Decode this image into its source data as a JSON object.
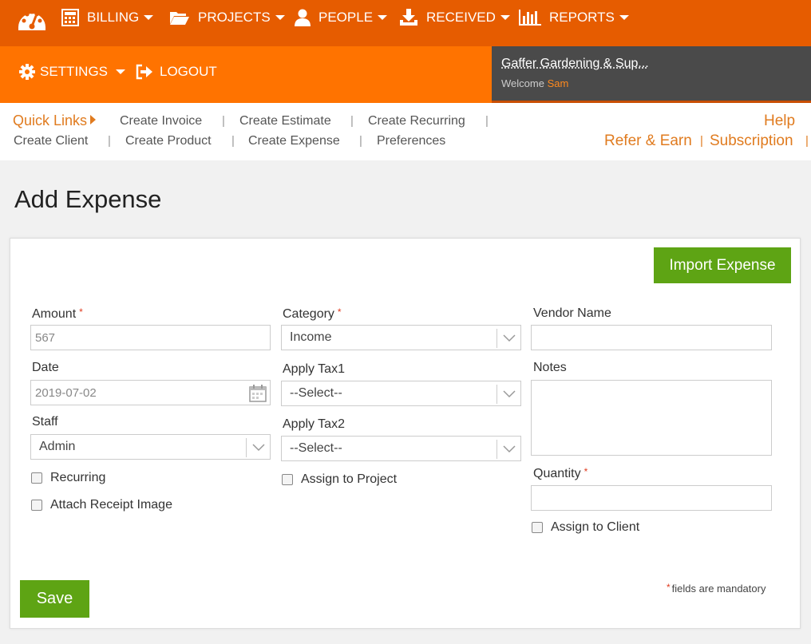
{
  "nav": {
    "items": [
      {
        "label": "BILLING",
        "icon": "calculator-icon"
      },
      {
        "label": "PROJECTS",
        "icon": "folder-open-icon"
      },
      {
        "label": "PEOPLE",
        "icon": "user-icon"
      },
      {
        "label": "RECEIVED",
        "icon": "download-tray-icon"
      },
      {
        "label": "REPORTS",
        "icon": "bar-chart-icon"
      }
    ],
    "settings_label": "SETTINGS",
    "logout_label": "LOGOUT"
  },
  "account": {
    "company": "Gaffer Gardening & Sup...",
    "welcome": "Welcome",
    "user": "Sam"
  },
  "quick_links": {
    "title": "Quick Links",
    "links": [
      "Create Invoice",
      "Create Estimate",
      "Create Recurring",
      "Create Client",
      "Create Product",
      "Create Expense",
      "Preferences"
    ],
    "help": "Help",
    "refer": "Refer & Earn",
    "subscription": "Subscription"
  },
  "page": {
    "title": "Add Expense"
  },
  "form": {
    "import_label": "Import Expense",
    "save_label": "Save",
    "amount": {
      "label": "Amount",
      "value": "567"
    },
    "date": {
      "label": "Date",
      "value": "2019-07-02"
    },
    "staff": {
      "label": "Staff",
      "value": "Admin"
    },
    "category": {
      "label": "Category",
      "value": "Income"
    },
    "tax1": {
      "label": "Apply Tax1",
      "value": "--Select--"
    },
    "tax2": {
      "label": "Apply Tax2",
      "value": "--Select--"
    },
    "vendor": {
      "label": "Vendor Name",
      "value": ""
    },
    "notes": {
      "label": "Notes",
      "value": ""
    },
    "quantity": {
      "label": "Quantity",
      "value": ""
    },
    "recurring_label": "Recurring",
    "attach_label": "Attach Receipt Image",
    "assign_project_label": "Assign to Project",
    "assign_client_label": "Assign to Client",
    "required_marker": "*",
    "mandatory_note": "fields are mandatory"
  },
  "colors": {
    "topbar": "#e65c00",
    "subbar": "#ff7300",
    "accent": "#e07b1f",
    "button_green": "#5ea414",
    "account_bg": "#4a4a4a"
  }
}
